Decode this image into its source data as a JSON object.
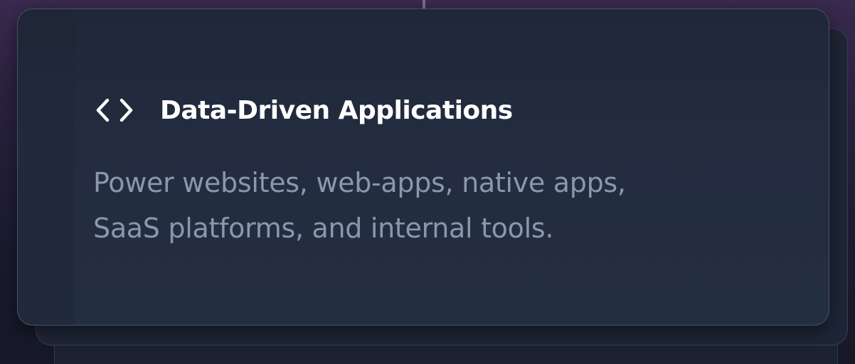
{
  "card": {
    "icon": "code-brackets-icon",
    "title": "Data-Driven Applications",
    "description_lines": [
      "Power websites, web-apps, native apps,",
      "SaaS platforms, and internal tools."
    ]
  },
  "colors": {
    "card_background": "#232c3f",
    "title": "#ffffff",
    "description": "#8a97ad"
  }
}
